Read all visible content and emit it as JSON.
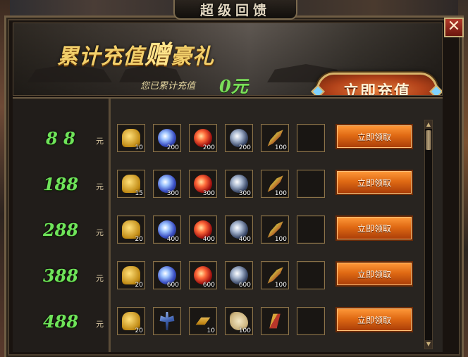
{
  "window": {
    "title": "超级回馈"
  },
  "banner": {
    "title_part1": "累计充值",
    "title_big": "赠",
    "title_part2": "豪礼",
    "recharged_label": "您已累计充值",
    "recharged_amount": "0元",
    "recharge_button": "立即充值"
  },
  "close_glyph": "✕",
  "unit_label": "元",
  "claim_label": "立即领取",
  "rows": [
    {
      "amount": "8 8",
      "items": [
        {
          "icon": "gold-ingot-icon",
          "count": "10"
        },
        {
          "icon": "blue-orb-icon",
          "count": "200"
        },
        {
          "icon": "red-orb-icon",
          "count": "200"
        },
        {
          "icon": "grey-orb-icon",
          "count": "200"
        },
        {
          "icon": "feather-icon",
          "count": "100"
        },
        {
          "icon": "empty-slot",
          "count": ""
        }
      ]
    },
    {
      "amount": "188",
      "items": [
        {
          "icon": "gold-ingot-icon",
          "count": "15"
        },
        {
          "icon": "blue-orb-icon",
          "count": "300"
        },
        {
          "icon": "red-orb-icon",
          "count": "300"
        },
        {
          "icon": "grey-orb-icon",
          "count": "300"
        },
        {
          "icon": "feather-icon",
          "count": "100"
        },
        {
          "icon": "empty-slot",
          "count": ""
        }
      ]
    },
    {
      "amount": "288",
      "items": [
        {
          "icon": "gold-ingot-icon",
          "count": "20"
        },
        {
          "icon": "blue-orb-icon",
          "count": "400"
        },
        {
          "icon": "red-orb-icon",
          "count": "400"
        },
        {
          "icon": "grey-orb-icon",
          "count": "400"
        },
        {
          "icon": "feather-icon",
          "count": "100"
        },
        {
          "icon": "empty-slot",
          "count": ""
        }
      ]
    },
    {
      "amount": "388",
      "items": [
        {
          "icon": "gold-ingot-icon",
          "count": "20"
        },
        {
          "icon": "blue-orb-icon",
          "count": "600"
        },
        {
          "icon": "red-orb-icon",
          "count": "600"
        },
        {
          "icon": "grey-orb-icon",
          "count": "600"
        },
        {
          "icon": "feather-icon",
          "count": "100"
        },
        {
          "icon": "empty-slot",
          "count": ""
        }
      ]
    },
    {
      "amount": "488",
      "items": [
        {
          "icon": "gold-ingot-icon",
          "count": "20"
        },
        {
          "icon": "battle-axe-icon",
          "count": ""
        },
        {
          "icon": "gold-bar-icon",
          "count": "10"
        },
        {
          "icon": "scroll-icon",
          "count": "100"
        },
        {
          "icon": "books-icon",
          "count": ""
        },
        {
          "icon": "empty-slot",
          "count": ""
        }
      ]
    }
  ],
  "scrollbar": {
    "up": "▲",
    "down": "▼"
  },
  "colors": {
    "amount_green": "#6fe35a",
    "gold": "#f2cf6a",
    "button_orange": "#e06a14"
  }
}
